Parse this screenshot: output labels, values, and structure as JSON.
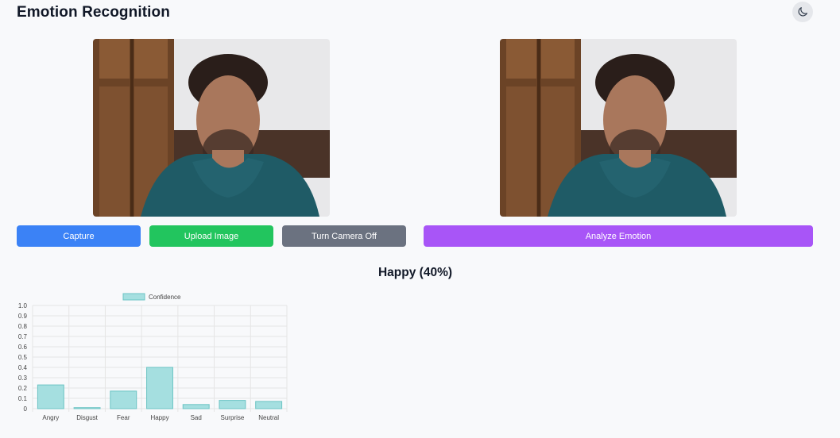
{
  "header": {
    "title": "Emotion Recognition",
    "theme_icon": "moon-icon"
  },
  "buttons": {
    "capture": "Capture",
    "upload": "Upload Image",
    "camera_off": "Turn Camera Off",
    "analyze": "Analyze Emotion"
  },
  "colors": {
    "capture": "#3b82f6",
    "upload": "#22c55e",
    "camera_off": "#6b7280",
    "analyze": "#a855f7",
    "bar_fill": "#a5dfe0",
    "bar_stroke": "#6cc4c4"
  },
  "result": {
    "label": "Happy (40%)"
  },
  "chart_data": {
    "type": "bar",
    "categories": [
      "Angry",
      "Disgust",
      "Fear",
      "Happy",
      "Sad",
      "Surprise",
      "Neutral"
    ],
    "series": [
      {
        "name": "Confidence",
        "values": [
          0.23,
          0.01,
          0.17,
          0.4,
          0.04,
          0.08,
          0.07
        ]
      }
    ],
    "ylim": [
      0,
      1.0
    ],
    "yticks": [
      "0",
      "0.1",
      "0.2",
      "0.3",
      "0.4",
      "0.5",
      "0.6",
      "0.7",
      "0.8",
      "0.9",
      "1.0"
    ],
    "legend": "top",
    "grid": true
  }
}
